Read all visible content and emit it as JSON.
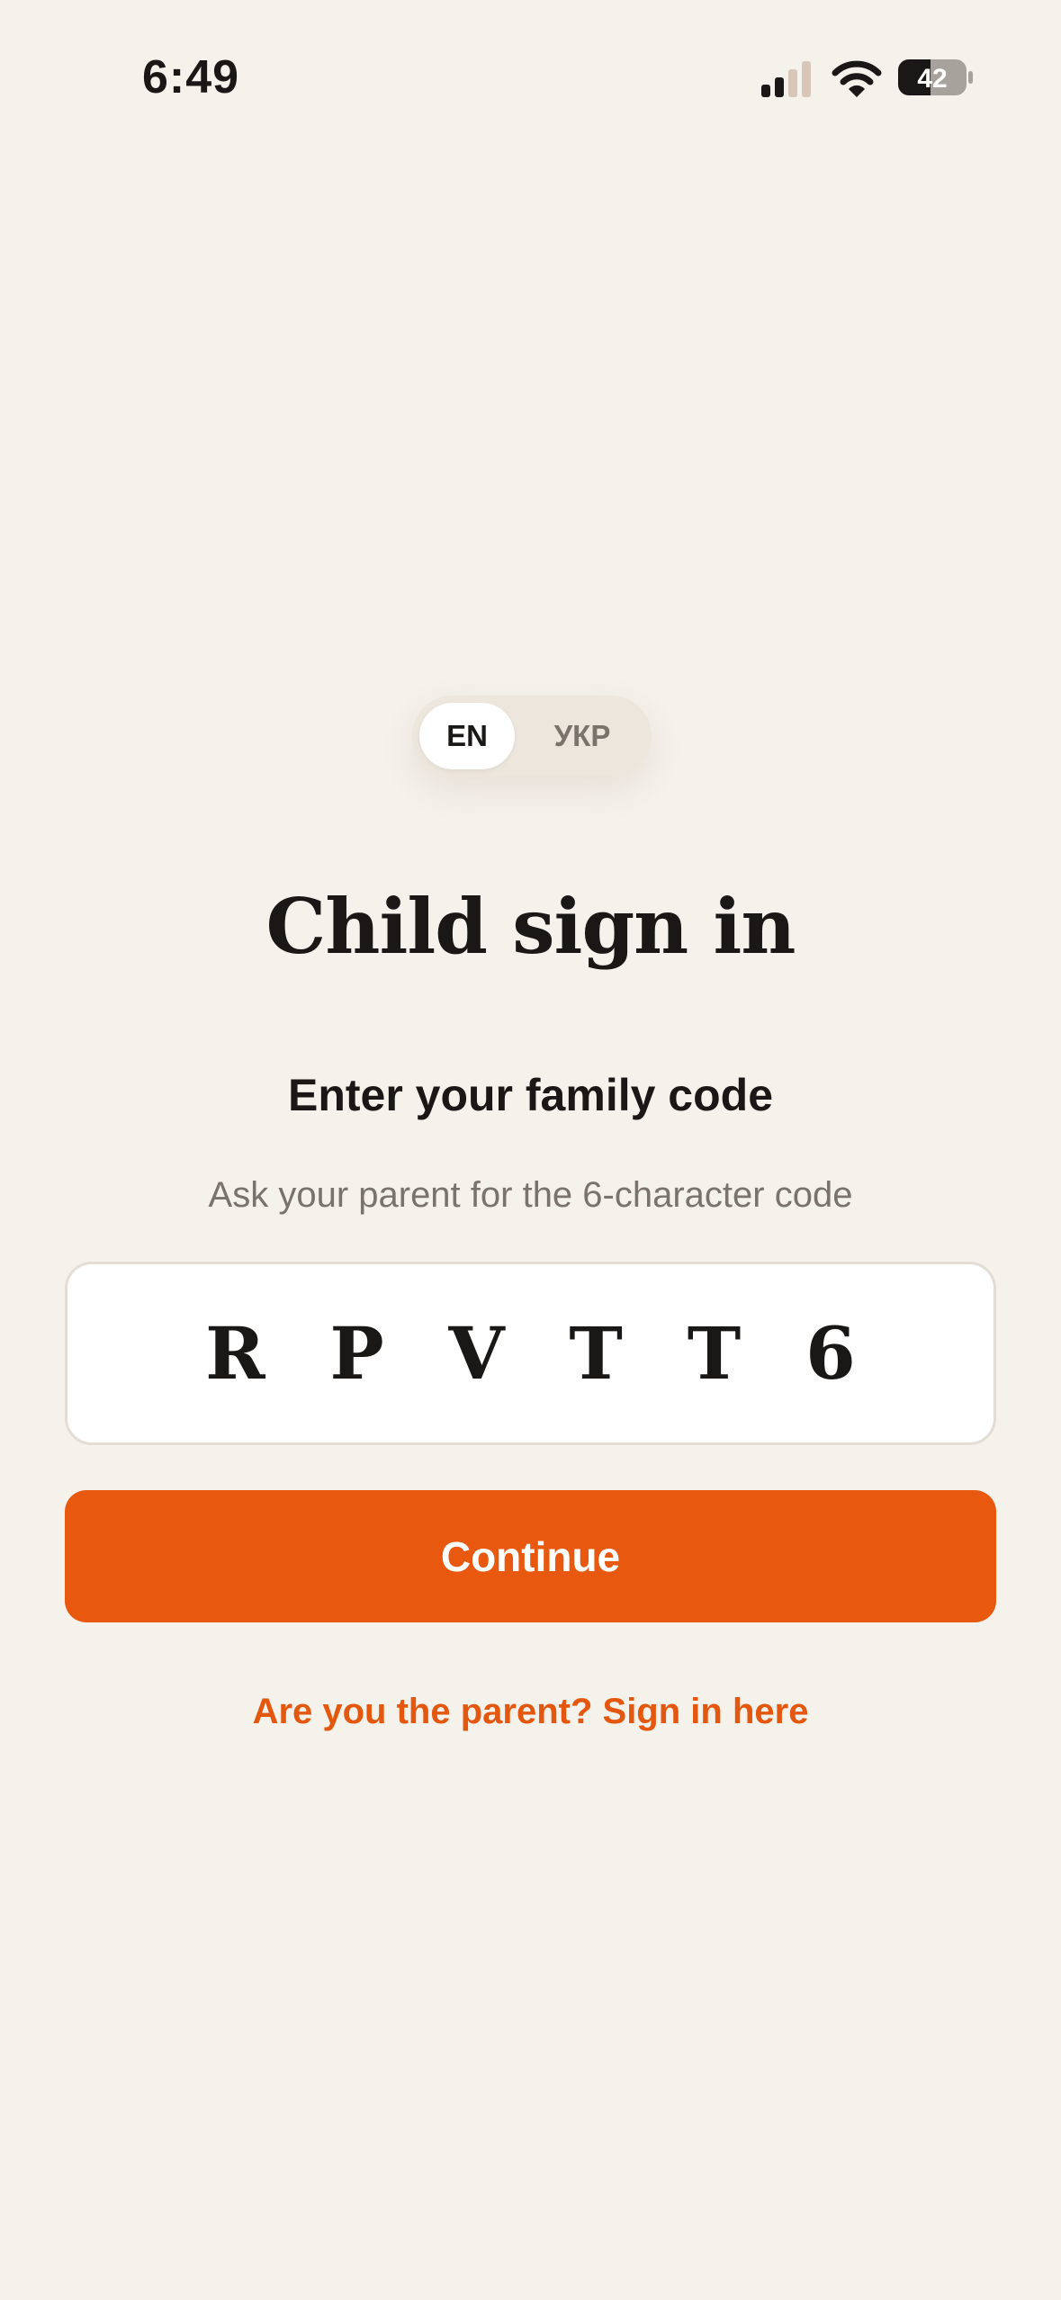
{
  "status_bar": {
    "time": "6:49",
    "battery": "42",
    "icons": [
      "signal-icon",
      "wifi-icon",
      "battery-icon"
    ]
  },
  "language_toggle": {
    "options": [
      {
        "label": "EN",
        "selected": true
      },
      {
        "label": "УКР",
        "selected": false
      }
    ]
  },
  "main": {
    "title": "Child sign in",
    "subtitle": "Enter your family code",
    "hint": "Ask your parent for the 6-character code",
    "code_input": {
      "value": "RPVTT6"
    },
    "continue_label": "Continue",
    "parent_link": "Are you the parent? Sign in here"
  },
  "colors": {
    "background": "#F5F1EB",
    "accent": "#E8580E",
    "text_primary": "#1A1816",
    "text_secondary": "#7A736B"
  }
}
